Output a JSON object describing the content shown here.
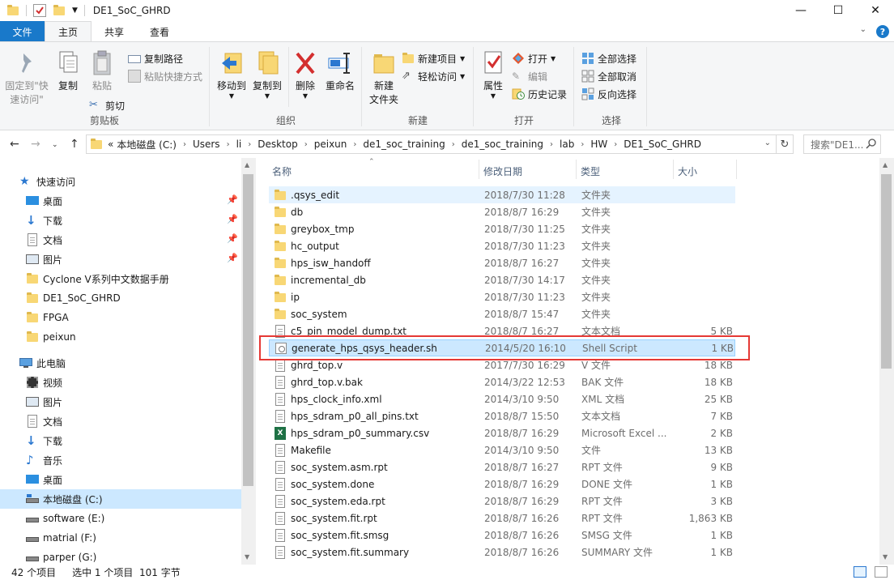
{
  "window": {
    "title": "DE1_SoC_GHRD",
    "controls": [
      "minimize",
      "maximize",
      "close"
    ]
  },
  "ribbon_tabs": [
    {
      "label": "文件"
    },
    {
      "label": "主页"
    },
    {
      "label": "共享"
    },
    {
      "label": "查看"
    }
  ],
  "ribbon": {
    "clipboard": {
      "pin_label": "固定到\"快\n速访问\"",
      "copy_label": "复制",
      "paste_label": "粘贴",
      "copy_path_label": "复制路径",
      "paste_shortcut_label": "粘贴快捷方式",
      "cut_label": "剪切",
      "group_label": "剪贴板"
    },
    "organize": {
      "move_to_label": "移动到",
      "copy_to_label": "复制到",
      "delete_label": "删除",
      "rename_label": "重命名",
      "group_label": "组织"
    },
    "new": {
      "new_folder_label": "新建\n文件夹",
      "new_item_label": "新建项目",
      "easy_access_label": "轻松访问",
      "group_label": "新建"
    },
    "open": {
      "properties_label": "属性",
      "open_label": "打开",
      "edit_label": "编辑",
      "history_label": "历史记录",
      "group_label": "打开"
    },
    "select": {
      "select_all_label": "全部选择",
      "select_none_label": "全部取消",
      "invert_label": "反向选择",
      "group_label": "选择"
    }
  },
  "address": {
    "overflow": "«",
    "breadcrumbs": [
      "本地磁盘 (C:)",
      "Users",
      "li",
      "Desktop",
      "peixun",
      "de1_soc_training",
      "de1_soc_training",
      "lab",
      "HW",
      "DE1_SoC_GHRD"
    ],
    "search_placeholder": "搜索\"DE1..."
  },
  "nav": {
    "quick_access_label": "快速访问",
    "quick_access": [
      {
        "label": "桌面",
        "icon": "desktop-icon",
        "pinned": true
      },
      {
        "label": "下载",
        "icon": "download-icon",
        "pinned": true
      },
      {
        "label": "文档",
        "icon": "documents-icon",
        "pinned": true
      },
      {
        "label": "图片",
        "icon": "pictures-icon",
        "pinned": true
      },
      {
        "label": "Cyclone V系列中文数据手册",
        "icon": "folder-icon",
        "pinned": false
      },
      {
        "label": "DE1_SoC_GHRD",
        "icon": "folder-icon",
        "pinned": false
      },
      {
        "label": "FPGA",
        "icon": "folder-icon",
        "pinned": false
      },
      {
        "label": "peixun",
        "icon": "folder-icon",
        "pinned": false
      }
    ],
    "this_pc_label": "此电脑",
    "this_pc": [
      {
        "label": "视频",
        "icon": "videos-icon"
      },
      {
        "label": "图片",
        "icon": "pictures-icon"
      },
      {
        "label": "文档",
        "icon": "documents-icon"
      },
      {
        "label": "下载",
        "icon": "download-icon"
      },
      {
        "label": "音乐",
        "icon": "music-icon"
      },
      {
        "label": "桌面",
        "icon": "desktop-icon"
      },
      {
        "label": "本地磁盘 (C:)",
        "icon": "drive-icon",
        "selected": true
      },
      {
        "label": "software (E:)",
        "icon": "drive-icon"
      },
      {
        "label": "matrial (F:)",
        "icon": "drive-icon"
      },
      {
        "label": "parper (G:)",
        "icon": "drive-icon"
      }
    ]
  },
  "columns": {
    "name": "名称",
    "date": "修改日期",
    "type": "类型",
    "size": "大小"
  },
  "files": [
    {
      "name": ".qsys_edit",
      "date": "2018/7/30 11:28",
      "type": "文件夹",
      "size": "",
      "icon": "folder-icon"
    },
    {
      "name": "db",
      "date": "2018/8/7 16:29",
      "type": "文件夹",
      "size": "",
      "icon": "folder-icon"
    },
    {
      "name": "greybox_tmp",
      "date": "2018/7/30 11:25",
      "type": "文件夹",
      "size": "",
      "icon": "folder-icon"
    },
    {
      "name": "hc_output",
      "date": "2018/7/30 11:23",
      "type": "文件夹",
      "size": "",
      "icon": "folder-icon"
    },
    {
      "name": "hps_isw_handoff",
      "date": "2018/8/7 16:27",
      "type": "文件夹",
      "size": "",
      "icon": "folder-icon"
    },
    {
      "name": "incremental_db",
      "date": "2018/7/30 14:17",
      "type": "文件夹",
      "size": "",
      "icon": "folder-icon"
    },
    {
      "name": "ip",
      "date": "2018/7/30 11:23",
      "type": "文件夹",
      "size": "",
      "icon": "folder-icon"
    },
    {
      "name": "soc_system",
      "date": "2018/8/7 15:47",
      "type": "文件夹",
      "size": "",
      "icon": "folder-icon"
    },
    {
      "name": "c5_pin_model_dump.txt",
      "date": "2018/8/7 16:27",
      "type": "文本文档",
      "size": "5 KB",
      "icon": "text-file-icon"
    },
    {
      "name": "generate_hps_qsys_header.sh",
      "date": "2014/5/20 16:10",
      "type": "Shell Script",
      "size": "1 KB",
      "icon": "shell-script-icon",
      "selected": true
    },
    {
      "name": "ghrd_top.v",
      "date": "2017/7/30 16:29",
      "type": "V 文件",
      "size": "18 KB",
      "icon": "file-icon"
    },
    {
      "name": "ghrd_top.v.bak",
      "date": "2014/3/22 12:53",
      "type": "BAK 文件",
      "size": "18 KB",
      "icon": "file-icon"
    },
    {
      "name": "hps_clock_info.xml",
      "date": "2014/3/10 9:50",
      "type": "XML 文档",
      "size": "25 KB",
      "icon": "file-icon"
    },
    {
      "name": "hps_sdram_p0_all_pins.txt",
      "date": "2018/8/7 15:50",
      "type": "文本文档",
      "size": "7 KB",
      "icon": "text-file-icon"
    },
    {
      "name": "hps_sdram_p0_summary.csv",
      "date": "2018/8/7 16:29",
      "type": "Microsoft Excel ...",
      "size": "2 KB",
      "icon": "excel-icon"
    },
    {
      "name": "Makefile",
      "date": "2014/3/10 9:50",
      "type": "文件",
      "size": "13 KB",
      "icon": "file-icon"
    },
    {
      "name": "soc_system.asm.rpt",
      "date": "2018/8/7 16:27",
      "type": "RPT 文件",
      "size": "9 KB",
      "icon": "file-icon"
    },
    {
      "name": "soc_system.done",
      "date": "2018/8/7 16:29",
      "type": "DONE 文件",
      "size": "1 KB",
      "icon": "file-icon"
    },
    {
      "name": "soc_system.eda.rpt",
      "date": "2018/8/7 16:29",
      "type": "RPT 文件",
      "size": "3 KB",
      "icon": "file-icon"
    },
    {
      "name": "soc_system.fit.rpt",
      "date": "2018/8/7 16:26",
      "type": "RPT 文件",
      "size": "1,863 KB",
      "icon": "file-icon"
    },
    {
      "name": "soc_system.fit.smsg",
      "date": "2018/8/7 16:26",
      "type": "SMSG 文件",
      "size": "1 KB",
      "icon": "file-icon"
    },
    {
      "name": "soc_system.fit.summary",
      "date": "2018/8/7 16:26",
      "type": "SUMMARY 文件",
      "size": "1 KB",
      "icon": "file-icon"
    }
  ],
  "status": {
    "count": "42 个项目",
    "selection": "选中 1 个项目  101 字节"
  }
}
